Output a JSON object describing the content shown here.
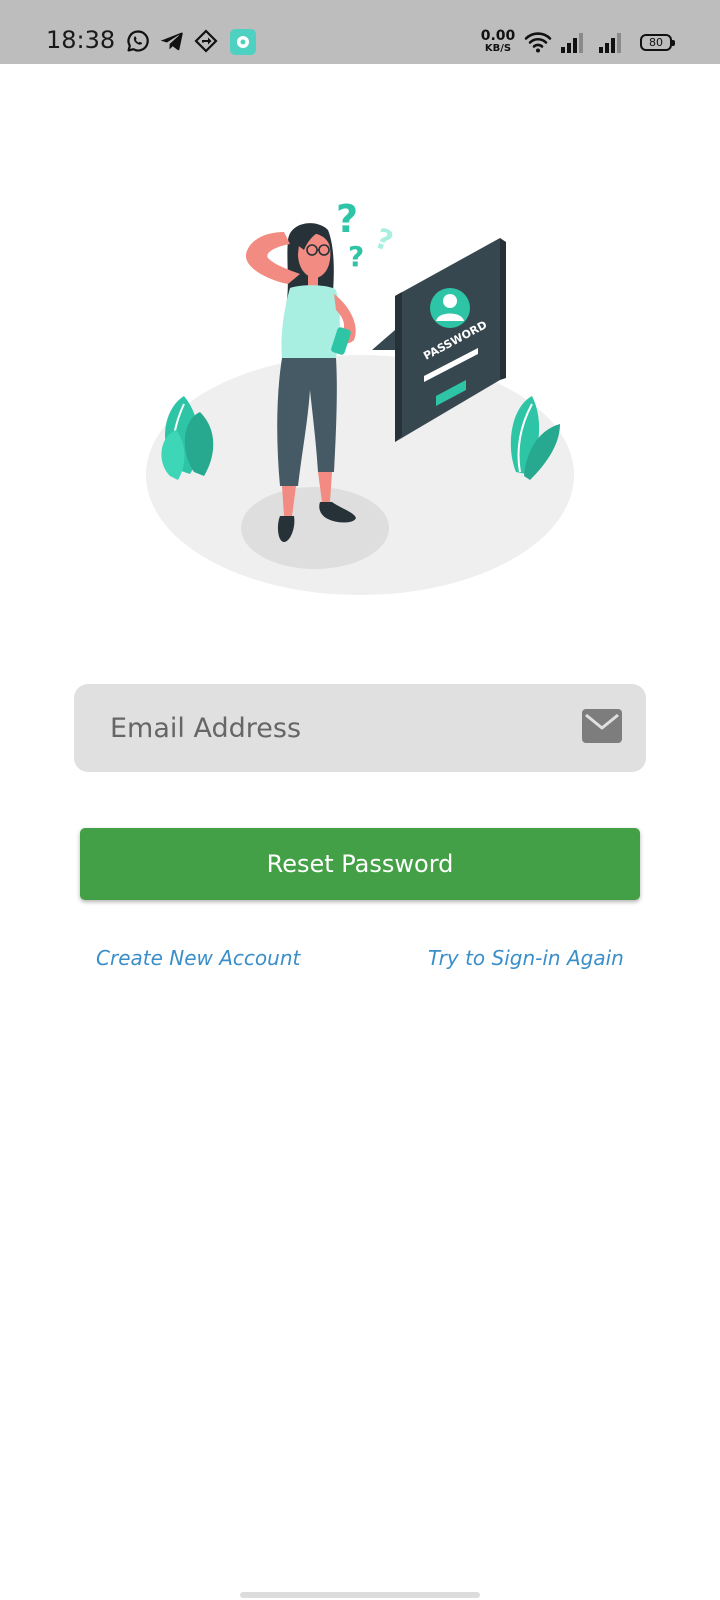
{
  "status_bar": {
    "time": "18:38",
    "notification_icons": [
      "whatsapp-icon",
      "telegram-icon",
      "navigation-app-icon",
      "app-notification-icon"
    ],
    "net_speed_value": "0.00",
    "net_speed_unit": "KB/S",
    "system_icons": [
      "wifi-icon",
      "signal-icon",
      "signal-icon"
    ],
    "battery": "80"
  },
  "illustration": {
    "card_label": "PASSWORD",
    "question_marks": [
      "?",
      "?",
      "?"
    ],
    "accent_color": "#2ec4a6"
  },
  "form": {
    "email_placeholder": "Email Address",
    "email_value": "",
    "email_icon": "mail-icon",
    "reset_button_label": "Reset Password",
    "button_color": "#43a047"
  },
  "links": {
    "create_account": "Create New Account",
    "sign_in_again": "Try to Sign-in Again",
    "link_color": "#3b8fc9"
  }
}
